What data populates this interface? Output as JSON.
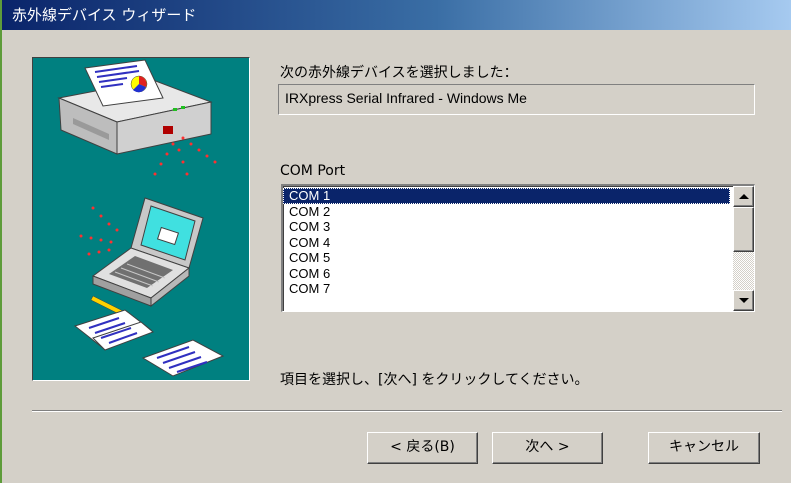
{
  "window": {
    "title": "赤外線デバイス ウィザード"
  },
  "main": {
    "selected_label": "次の赤外線デバイスを選択しました：",
    "selected_device": "IRXpress Serial Infrared - Windows Me",
    "com_port_label": "COM Port",
    "com_ports": [
      "COM 1",
      "COM 2",
      "COM 3",
      "COM 4",
      "COM 5",
      "COM 6",
      "COM 7"
    ],
    "selected_port": "COM 1",
    "instruction": "項目を選択し、[次へ] をクリックしてください。"
  },
  "buttons": {
    "back": "< 戻る(B)",
    "next": "次へ >",
    "cancel": "キャンセル"
  },
  "colors": {
    "title_start": "#0a246a",
    "title_end": "#a6caf0",
    "dialog_bg": "#d4d0c8",
    "illustration_bg": "#008080",
    "selection": "#0a246a"
  },
  "icons": {
    "illustration": "printer-laptop-infrared-illustration"
  }
}
